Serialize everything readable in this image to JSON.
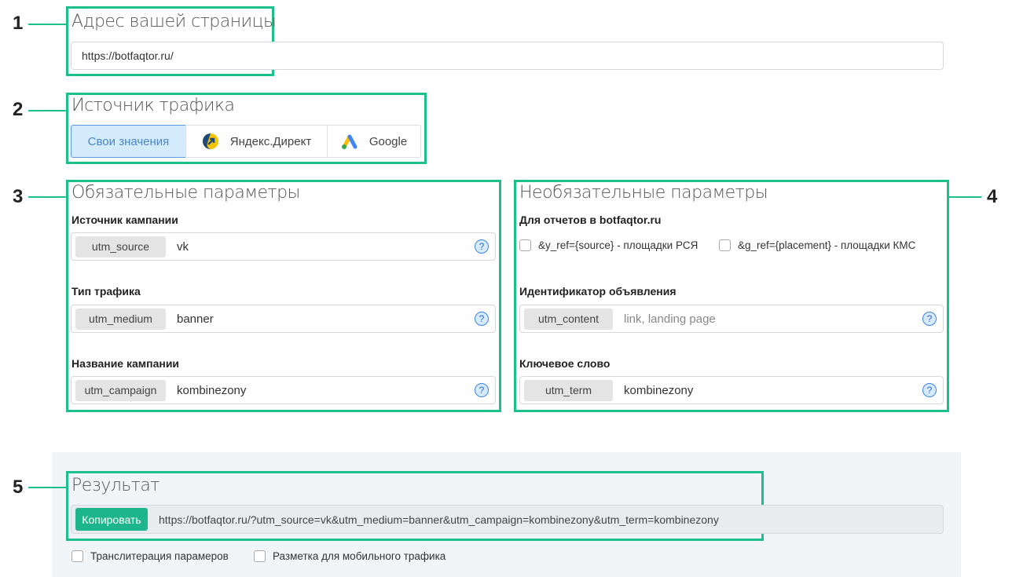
{
  "markers": [
    "1",
    "2",
    "3",
    "4",
    "5"
  ],
  "url_section": {
    "title": "Адрес вашей страницы",
    "value": "https://botfaqtor.ru/"
  },
  "traffic_source": {
    "title": "Источник трафика",
    "options": [
      {
        "label": "Свои значения",
        "icon": "none",
        "active": true
      },
      {
        "label": "Яндекс.Директ",
        "icon": "yandex-direct-icon"
      },
      {
        "label": "Google",
        "icon": "google-ads-icon"
      }
    ]
  },
  "required": {
    "title": "Обязательные параметры",
    "fields": [
      {
        "label": "Источник кампании",
        "param": "utm_source",
        "value": "vk"
      },
      {
        "label": "Тип трафика",
        "param": "utm_medium",
        "value": "banner"
      },
      {
        "label": "Название кампании",
        "param": "utm_campaign",
        "value": "kombinezony"
      }
    ]
  },
  "optional": {
    "title": "Необязательные параметры",
    "reports_label": "Для отчетов в botfaqtor.ru",
    "checkboxes": [
      "&y_ref={source} - площадки РСЯ",
      "&g_ref={placement} - площадки КМС"
    ],
    "fields": [
      {
        "label": "Идентификатор объявления",
        "param": "utm_content",
        "value": "",
        "placeholder": "link, landing page"
      },
      {
        "label": "Ключевое слово",
        "param": "utm_term",
        "value": "kombinezony"
      }
    ]
  },
  "help_glyph": "?",
  "result": {
    "title": "Результат",
    "copy_label": "Копировать",
    "value": "https://botfaqtor.ru/?utm_source=vk&utm_medium=banner&utm_campaign=kombinezony&utm_term=kombinezony",
    "options": [
      "Транслитерация парамеров",
      "Разметка для мобильного трафика"
    ]
  },
  "colors": {
    "accent": "#1dbf8a",
    "active_bg": "#d4ebfc",
    "copy_btn": "#1db58b"
  }
}
